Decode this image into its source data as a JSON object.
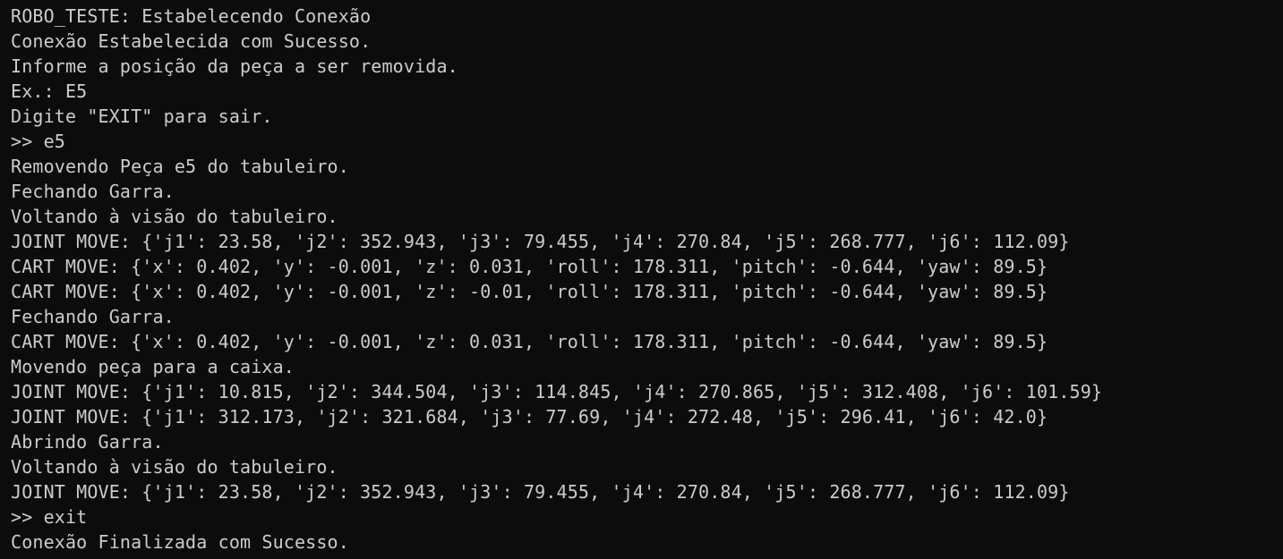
{
  "terminal": {
    "lines": [
      "ROBO_TESTE: Estabelecendo Conexão",
      "Conexão Estabelecida com Sucesso.",
      "Informe a posição da peça a ser removida.",
      "Ex.: E5",
      "Digite \"EXIT\" para sair.",
      ">> e5",
      "Removendo Peça e5 do tabuleiro.",
      "Fechando Garra.",
      "Voltando à visão do tabuleiro.",
      "JOINT MOVE: {'j1': 23.58, 'j2': 352.943, 'j3': 79.455, 'j4': 270.84, 'j5': 268.777, 'j6': 112.09}",
      "CART MOVE: {'x': 0.402, 'y': -0.001, 'z': 0.031, 'roll': 178.311, 'pitch': -0.644, 'yaw': 89.5}",
      "CART MOVE: {'x': 0.402, 'y': -0.001, 'z': -0.01, 'roll': 178.311, 'pitch': -0.644, 'yaw': 89.5}",
      "Fechando Garra.",
      "CART MOVE: {'x': 0.402, 'y': -0.001, 'z': 0.031, 'roll': 178.311, 'pitch': -0.644, 'yaw': 89.5}",
      "Movendo peça para a caixa.",
      "JOINT MOVE: {'j1': 10.815, 'j2': 344.504, 'j3': 114.845, 'j4': 270.865, 'j5': 312.408, 'j6': 101.59}",
      "JOINT MOVE: {'j1': 312.173, 'j2': 321.684, 'j3': 77.69, 'j4': 272.48, 'j5': 296.41, 'j6': 42.0}",
      "Abrindo Garra.",
      "Voltando à visão do tabuleiro.",
      "JOINT MOVE: {'j1': 23.58, 'j2': 352.943, 'j3': 79.455, 'j4': 270.84, 'j5': 268.777, 'j6': 112.09}",
      ">> exit",
      "Conexão Finalizada com Sucesso."
    ]
  }
}
